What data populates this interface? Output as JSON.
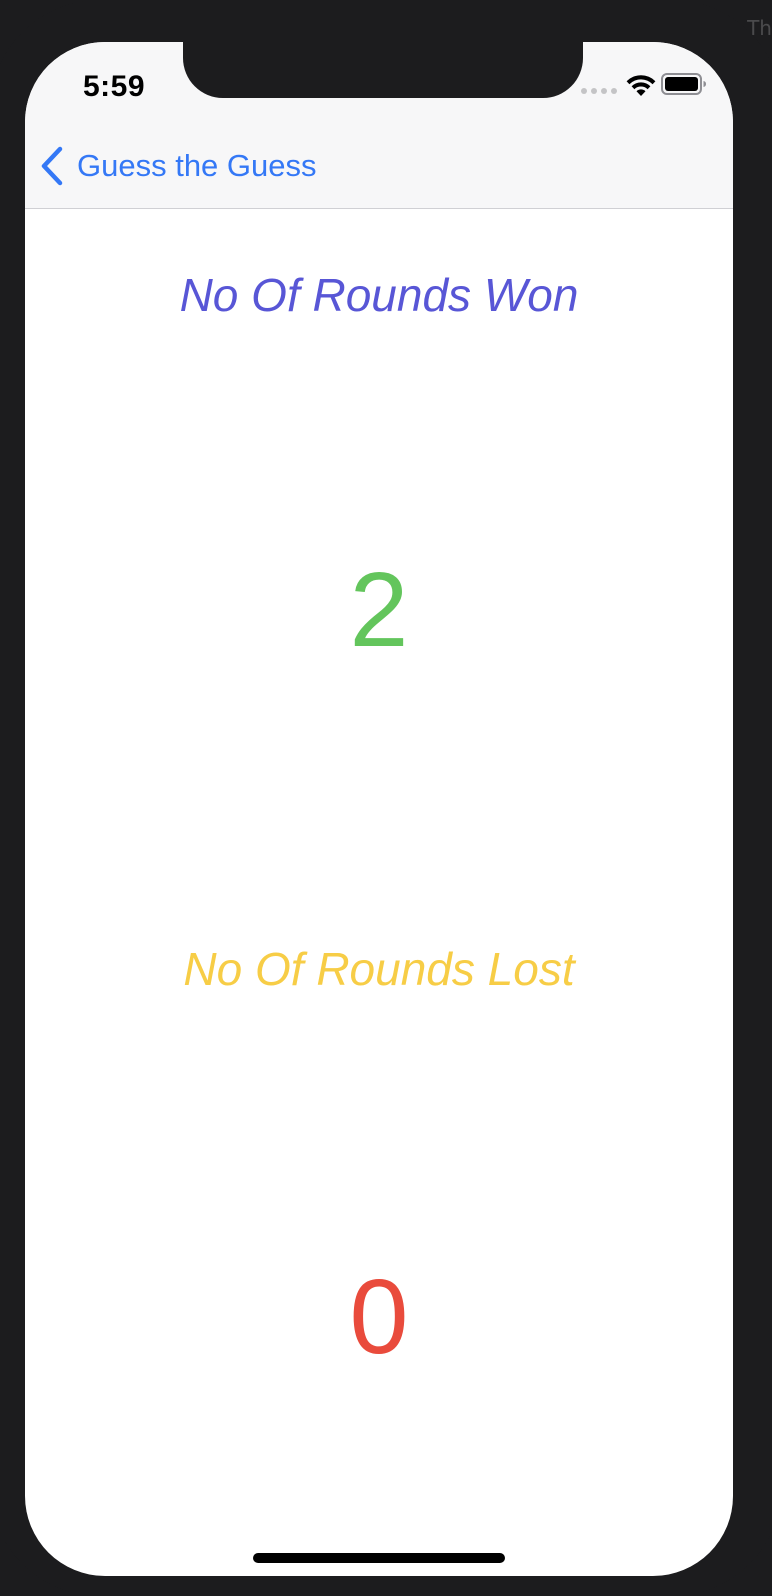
{
  "simulator": {
    "corner_text": "Th"
  },
  "status_bar": {
    "time": "5:59",
    "icons": [
      "signal-dots-icon",
      "wifi-icon",
      "battery-icon"
    ]
  },
  "nav_bar": {
    "back_label": "Guess the Guess",
    "back_icon": "chevron-left-icon"
  },
  "score": {
    "won_label": "No Of Rounds Won",
    "won_count": "2",
    "lost_label": "No Of Rounds Lost",
    "lost_count": "0"
  },
  "colors": {
    "accent": "#3478f6",
    "won_label": "#5856d6",
    "won_count": "#63c55c",
    "lost_label": "#f7cd46",
    "lost_count": "#e94b3c"
  }
}
